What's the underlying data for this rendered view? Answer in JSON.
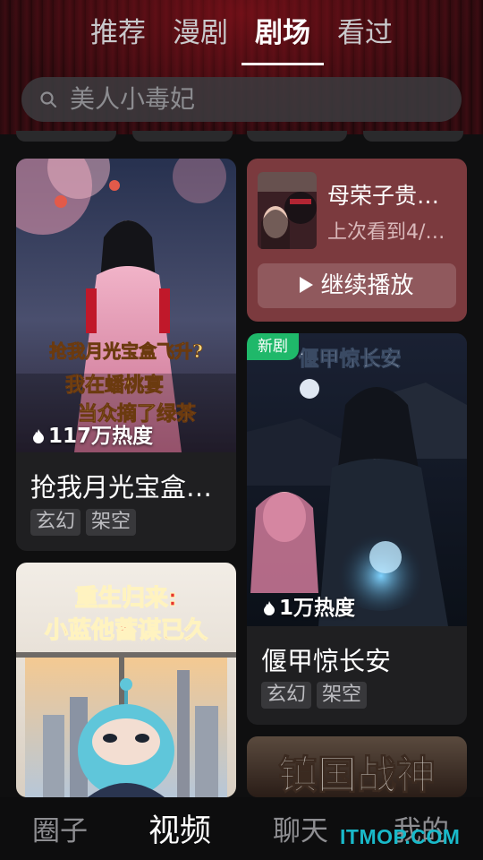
{
  "tabs": [
    "推荐",
    "漫剧",
    "剧场",
    "看过"
  ],
  "active_tab": 2,
  "search": {
    "placeholder": "美人小毒妃",
    "icon": "search-icon"
  },
  "history_card": {
    "title": "母荣子贵…",
    "subtitle": "上次看到4/…",
    "play_label": "继续播放",
    "accent": "#7b3a3e"
  },
  "dramas": [
    {
      "heat": "117万热度",
      "title": "抢我月光宝盒…",
      "tags": [
        "玄幻",
        "架空"
      ],
      "poster_text": [
        "抢我月光宝盒飞升?",
        "我在蟠桃宴",
        "当众摘了绿茶"
      ]
    },
    {
      "badge": "新剧",
      "heat": "1万热度",
      "title": "偃甲惊长安",
      "tags": [
        "玄幻",
        "架空"
      ],
      "poster_text": [
        "偃甲惊长安"
      ]
    },
    {
      "poster_text": [
        "重生归来:",
        "小蓝他蓄谋已久"
      ]
    },
    {
      "poster_text": [
        "镇国战神"
      ]
    }
  ],
  "bottom_nav": [
    "圈子",
    "视频",
    "聊天",
    "我的"
  ],
  "active_bottom": 1,
  "watermark": "ITMOP.COM",
  "colors": {
    "badge_green": "#1fb86a",
    "brand_red": "#8b1a22"
  }
}
